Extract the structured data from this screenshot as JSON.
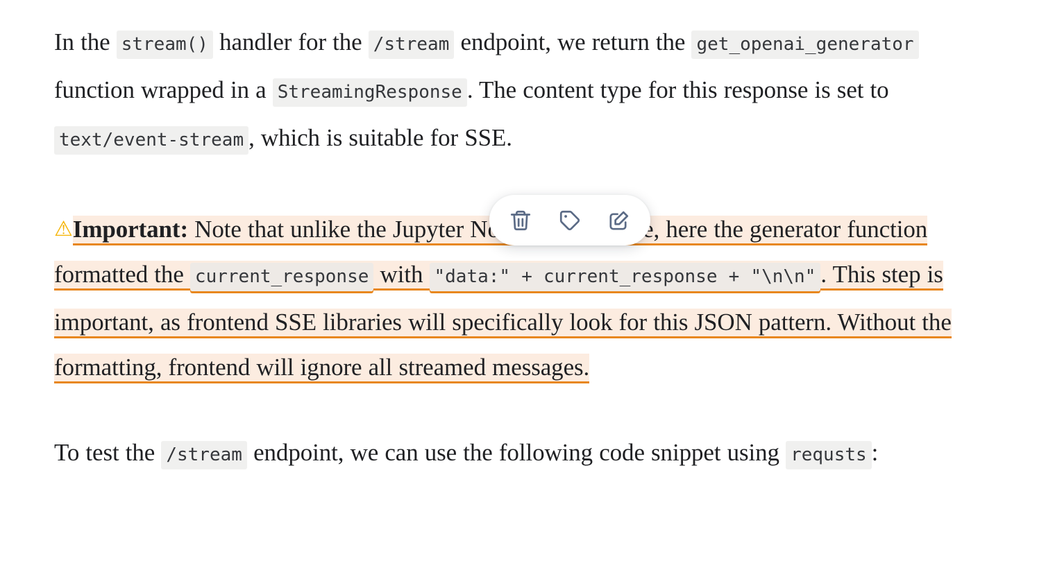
{
  "document": {
    "paragraph1": {
      "segments": [
        {
          "type": "text",
          "value": "In the "
        },
        {
          "type": "code",
          "value": "stream()"
        },
        {
          "type": "text",
          "value": " handler for the "
        },
        {
          "type": "code",
          "value": "/stream"
        },
        {
          "type": "text",
          "value": " endpoint, we return the "
        },
        {
          "type": "code",
          "value": "get_openai_generator"
        },
        {
          "type": "text",
          "value": " function wrapped in a "
        },
        {
          "type": "code",
          "value": "StreamingResponse"
        },
        {
          "type": "text",
          "value": ". The content type for this response is set to "
        },
        {
          "type": "code",
          "value": "text/event-stream"
        },
        {
          "type": "text",
          "value": ", which is suitable for SSE."
        }
      ],
      "t1": "In the ",
      "c1": "stream()",
      "t2": " handler for the ",
      "c2": "/stream",
      "t3": " endpoint, we return the ",
      "c3": "get_openai_generator",
      "t4": " function wrapped in a ",
      "c4": "StreamingResponse",
      "t5": ". The content type for this response is set to ",
      "c5": "text/event-stream",
      "t6": ", which is suitable for SSE."
    },
    "paragraph2_highlighted": {
      "warning_icon": "⚠",
      "label_bold": "Important:",
      "t1": " Note that unlike the Jupyter Notebook example, here the generator function formatted the ",
      "c1": "current_response",
      "t2": " with ",
      "c2": "\"data:\" + current_response + \"\\n\\n\"",
      "t3": ". This step is important, as frontend SSE libraries will specifically look for this JSON pattern. Without the formatting, frontend will ignore all streamed messages.",
      "highlight_color": "#fcece0",
      "underline_color": "#e8871e"
    },
    "paragraph3": {
      "t1": "To test the ",
      "c1": "/stream",
      "t2": " endpoint, we can use the following code snippet using ",
      "c2": "requsts",
      "t3": ":"
    }
  },
  "annotation_toolbar": {
    "buttons": [
      {
        "name": "delete",
        "icon": "trash-icon",
        "label": "Delete"
      },
      {
        "name": "tag",
        "icon": "tag-icon",
        "label": "Tag"
      },
      {
        "name": "edit",
        "icon": "edit-note-icon",
        "label": "Edit note"
      }
    ],
    "icon_color": "#5b6b86",
    "background": "#ffffff"
  }
}
